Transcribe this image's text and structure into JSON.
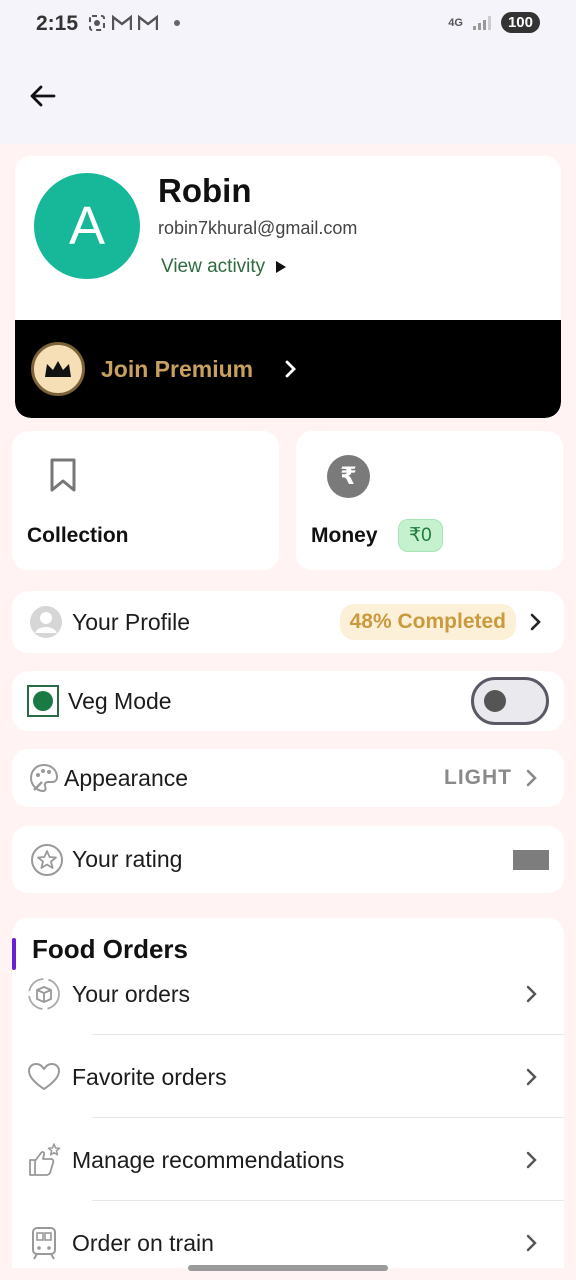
{
  "status_bar": {
    "time": "2:15",
    "icons": [
      "screenshot-icon",
      "gmail-icon",
      "gmail-icon"
    ],
    "network": "4G",
    "battery": "100"
  },
  "profile": {
    "avatar_letter": "A",
    "name": "Robin",
    "email": "robin7khural@gmail.com",
    "view_activity": "View activity"
  },
  "premium": {
    "label": "Join Premium"
  },
  "tiles": {
    "collection": "Collection",
    "money": "Money",
    "money_value": "₹0",
    "rupee_symbol": "₹"
  },
  "rows": {
    "profile_label": "Your Profile",
    "profile_completion": "48% Completed",
    "veg_label": "Veg Mode",
    "veg_enabled": false,
    "appearance_label": "Appearance",
    "appearance_value": "LIGHT",
    "rating_label": "Your rating"
  },
  "food_orders": {
    "title": "Food Orders",
    "items": [
      {
        "label": "Your orders",
        "icon": "box-icon"
      },
      {
        "label": "Favorite orders",
        "icon": "heart-icon"
      },
      {
        "label": "Manage recommendations",
        "icon": "thumbs-up-icon"
      },
      {
        "label": "Order on train",
        "icon": "train-icon"
      }
    ]
  },
  "colors": {
    "avatar_bg": "#17b89a",
    "premium_gold": "#c9a15f",
    "section_accent": "#6a1fd1",
    "veg_green": "#1b7a44"
  }
}
